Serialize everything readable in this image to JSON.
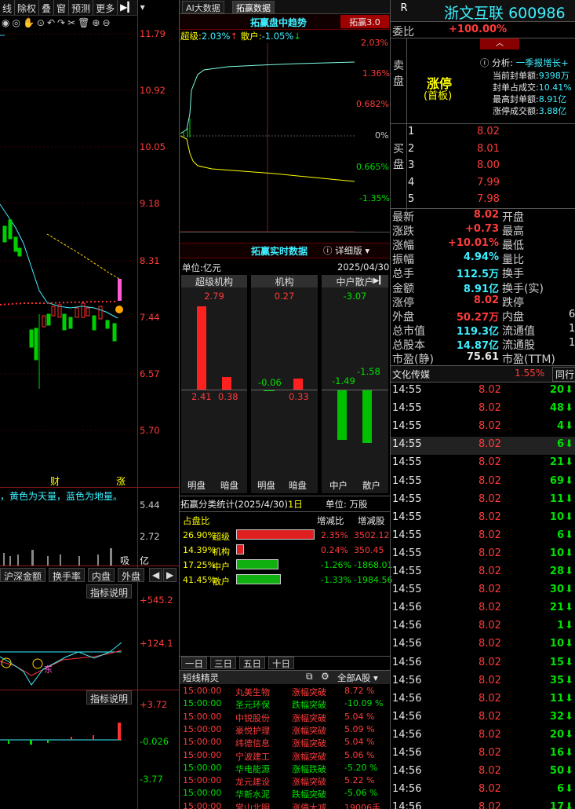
{
  "toolbar": {
    "items": [
      "线",
      "除权",
      "叠",
      "窗",
      "预测",
      "更多"
    ],
    "icons": [
      "eye-icon",
      "eye-off-icon",
      "hand-icon",
      "play-icon",
      "undo-icon",
      "redo-icon",
      "scissors-icon",
      "trash-icon",
      "plus-circle-icon",
      "minus-circle-icon"
    ]
  },
  "left_chart": {
    "price_ticks": [
      "11.79",
      "10.92",
      "10.05",
      "9.18",
      "8.31",
      "7.44",
      "6.57",
      "5.70"
    ],
    "markers": [
      "财",
      "涨"
    ],
    "legend_text": "，黄色为天量，蓝色为地量。",
    "volume_ticks": [
      "5.44",
      "2.72"
    ],
    "volume_unit": "亿",
    "volume_marker": "吸",
    "tabs": [
      "沪深金额",
      "换手率",
      "内盘",
      "外盘"
    ],
    "indicator_button": "指标说明",
    "ind1_ticks": [
      "+545.2",
      "+124.1"
    ],
    "ind1_label": "东",
    "ind2_ticks": [
      "+3.72",
      "-0.026",
      "-3.77"
    ]
  },
  "mid_top_tabs": [
    "AI大数据",
    "拓赢数据"
  ],
  "trend": {
    "title": "拓赢盘中趋势",
    "version": "拓赢3.0",
    "super_label": "超级:",
    "super_value": "2.03%",
    "retail_label": "散户:",
    "retail_value": "-1.05%",
    "pct_ticks": [
      "2.03%",
      "1.36%",
      "0.682%",
      "0%",
      "0.665%",
      "-1.35%"
    ]
  },
  "realtime": {
    "title": "拓赢实时数据",
    "detail": "详细版",
    "unit": "单位:亿元",
    "date": "2025/04/30",
    "cols": [
      {
        "name": "超级机构",
        "net": "2.79",
        "bright": "2.41",
        "dark": "0.38"
      },
      {
        "name": "机构",
        "net": "0.27",
        "bright": "-0.06",
        "dark": "0.33"
      },
      {
        "name": "中户散户",
        "net": "-3.07",
        "bright": "-1.49",
        "dark": "-1.58"
      }
    ],
    "bottom_labels": [
      "明盘",
      "暗盘",
      "明盘",
      "暗盘",
      "中户",
      "散户"
    ]
  },
  "category_stats": {
    "title": "拓赢分类统计(2025/4/30)",
    "days_label": "1日",
    "unit": "单位: 万股",
    "col_share": "占盘比",
    "col_chg_pct": "增减比",
    "col_chg_shares": "增减股",
    "rows": [
      {
        "share": "26.90%",
        "name": "超级",
        "pct": "2.35%",
        "shares": "3502.12",
        "fill": 1.0,
        "color": "#e02020"
      },
      {
        "share": "14.39%",
        "name": "机构",
        "pct": "0.24%",
        "shares": "350.45",
        "fill": 0.1,
        "color": "#e02020"
      },
      {
        "share": "17.25%",
        "name": "中户",
        "pct": "-1.26%",
        "shares": "-1868.01",
        "fill": 0.54,
        "color": "#10b010"
      },
      {
        "share": "41.45%",
        "name": "散户",
        "pct": "-1.33%",
        "shares": "-1984.56",
        "fill": 0.57,
        "color": "#10b010"
      }
    ]
  },
  "period_tabs": [
    "一日",
    "三日",
    "五日",
    "十日"
  ],
  "short_line": {
    "title": "短线精灵",
    "filter": "全部A股",
    "rows": [
      {
        "time": "15:00:00",
        "name": "丸美生物",
        "event": "涨幅突破",
        "value": "8.72 %",
        "up": true
      },
      {
        "time": "15:00:00",
        "name": "圣元环保",
        "event": "跌幅突破",
        "value": "-10.09 %",
        "up": false
      },
      {
        "time": "15:00:00",
        "name": "中锐股份",
        "event": "涨幅突破",
        "value": "5.04 %",
        "up": true
      },
      {
        "time": "15:00:00",
        "name": "豪悦护理",
        "event": "涨幅突破",
        "value": "5.09 %",
        "up": true
      },
      {
        "time": "15:00:00",
        "name": "纬德信息",
        "event": "涨幅突破",
        "value": "5.04 %",
        "up": true
      },
      {
        "time": "15:00:00",
        "name": "宁波建工",
        "event": "涨幅突破",
        "value": "5.06 %",
        "up": true
      },
      {
        "time": "15:00:00",
        "name": "华电能源",
        "event": "涨幅跌破",
        "value": "-5.20 %",
        "up": false
      },
      {
        "time": "15:00:00",
        "name": "龙元建设",
        "event": "涨幅突破",
        "value": "5.22 %",
        "up": true
      },
      {
        "time": "15:00:00",
        "name": "华新水泥",
        "event": "跌幅突破",
        "value": "-5.06 %",
        "up": false
      },
      {
        "time": "15:00:00",
        "name": "常山北明",
        "event": "涨停大减",
        "value": "19006手",
        "up": true
      }
    ]
  },
  "stock": {
    "badge": "R",
    "name": "浙文互联",
    "code": "600986",
    "ratio_label": "委比",
    "ratio_value": "+100.00%",
    "sell_label": "卖盘",
    "buy_label": "买盘",
    "limit_label": "涨停",
    "limit_sub": "(首板)",
    "analysis_label": "分析:",
    "analysis_value": "一季报增长+",
    "info": [
      {
        "k": "当前封单额:",
        "v": "9398万"
      },
      {
        "k": "封单占成交:",
        "v": "10.41%"
      },
      {
        "k": "最高封单额:",
        "v": "8.91亿"
      },
      {
        "k": "涨停成交额:",
        "v": "3.88亿"
      }
    ],
    "bids": [
      {
        "n": "1",
        "p": "8.02"
      },
      {
        "n": "2",
        "p": "8.01"
      },
      {
        "n": "3",
        "p": "8.00"
      },
      {
        "n": "4",
        "p": "7.99"
      },
      {
        "n": "5",
        "p": "7.98"
      }
    ],
    "quote_left": [
      {
        "k": "最新",
        "v": "8.02",
        "c": "red"
      },
      {
        "k": "涨跌",
        "v": "+0.73",
        "c": "red"
      },
      {
        "k": "涨幅",
        "v": "+10.01%",
        "c": "red"
      },
      {
        "k": "振幅",
        "v": "4.94%",
        "c": "cyan"
      },
      {
        "k": "总手",
        "v": "112.5万",
        "c": "cyan"
      },
      {
        "k": "金额",
        "v": "8.91亿",
        "c": "cyan"
      },
      {
        "k": "涨停",
        "v": "8.02",
        "c": "red"
      },
      {
        "k": "外盘",
        "v": "50.27万",
        "c": "red"
      },
      {
        "k": "总市值",
        "v": "119.3亿",
        "c": "cyan"
      },
      {
        "k": "总股本",
        "v": "14.87亿",
        "c": "cyan"
      },
      {
        "k": "市盈(静)",
        "v": "75.61",
        "c": "white"
      }
    ],
    "quote_right": [
      {
        "k": "开盘",
        "v": ""
      },
      {
        "k": "最高",
        "v": ""
      },
      {
        "k": "最低",
        "v": ""
      },
      {
        "k": "量比",
        "v": ""
      },
      {
        "k": "换手",
        "v": ""
      },
      {
        "k": "换手(实)",
        "v": ""
      },
      {
        "k": "跌停",
        "v": ""
      },
      {
        "k": "内盘",
        "v": "6"
      },
      {
        "k": "流通值",
        "v": "1"
      },
      {
        "k": "流通股",
        "v": "1"
      },
      {
        "k": "市盈(TTM)",
        "v": ""
      }
    ],
    "sector_name": "文化传媒",
    "sector_pct": "1.55%",
    "sector_tab": "同行"
  },
  "ticks": [
    {
      "t": "14:55",
      "p": "8.02",
      "v": "20"
    },
    {
      "t": "14:55",
      "p": "8.02",
      "v": "48"
    },
    {
      "t": "14:55",
      "p": "8.02",
      "v": "4"
    },
    {
      "t": "14:55",
      "p": "8.02",
      "v": "6"
    },
    {
      "t": "14:55",
      "p": "8.02",
      "v": "21"
    },
    {
      "t": "14:55",
      "p": "8.02",
      "v": "69"
    },
    {
      "t": "14:55",
      "p": "8.02",
      "v": "11"
    },
    {
      "t": "14:55",
      "p": "8.02",
      "v": "10"
    },
    {
      "t": "14:55",
      "p": "8.02",
      "v": "6"
    },
    {
      "t": "14:55",
      "p": "8.02",
      "v": "10"
    },
    {
      "t": "14:55",
      "p": "8.02",
      "v": "28"
    },
    {
      "t": "14:55",
      "p": "8.02",
      "v": "30"
    },
    {
      "t": "14:56",
      "p": "8.02",
      "v": "21"
    },
    {
      "t": "14:56",
      "p": "8.02",
      "v": "1"
    },
    {
      "t": "14:56",
      "p": "8.02",
      "v": "10"
    },
    {
      "t": "14:56",
      "p": "8.02",
      "v": "15"
    },
    {
      "t": "14:56",
      "p": "8.02",
      "v": "35"
    },
    {
      "t": "14:56",
      "p": "8.02",
      "v": "11"
    },
    {
      "t": "14:56",
      "p": "8.02",
      "v": "32"
    },
    {
      "t": "14:56",
      "p": "8.02",
      "v": "20"
    },
    {
      "t": "14:56",
      "p": "8.02",
      "v": "16"
    },
    {
      "t": "14:56",
      "p": "8.02",
      "v": "50"
    },
    {
      "t": "14:56",
      "p": "8.02",
      "v": "6"
    },
    {
      "t": "14:56",
      "p": "8.02",
      "v": "17"
    }
  ]
}
